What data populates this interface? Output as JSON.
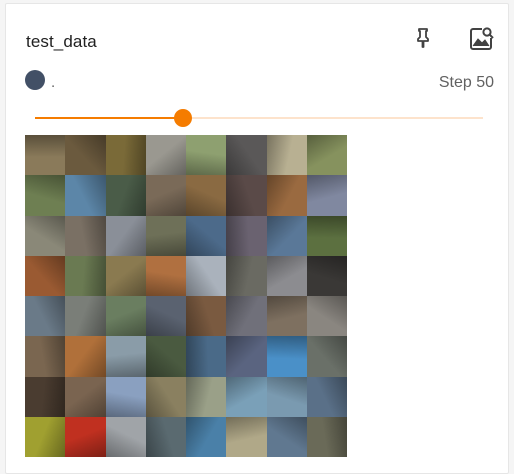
{
  "card": {
    "title": "test_data",
    "run_label": ".",
    "run_color": "#425066",
    "step_label": "Step 50"
  },
  "icons": {
    "pin": "pin-icon",
    "image_search": "image-search-icon"
  },
  "slider": {
    "value_fraction": 0.33,
    "accent": "#f57c00",
    "track_color": "#fde3cc"
  },
  "image_grid": {
    "rows": 8,
    "cols": 8,
    "tiles": [
      "#8a7a5a",
      "#6b5a3e",
      "#7a6a38",
      "#9a9890",
      "#8ea070",
      "#5a5858",
      "#b8b092",
      "#86925e",
      "#6e7f52",
      "#5c86a8",
      "#4a5c48",
      "#7a6a58",
      "#8a6a42",
      "#5a4a48",
      "#9a6a40",
      "#8088a0",
      "#8a8878",
      "#7a7064",
      "#8a8f98",
      "#6e7058",
      "#4c6a8a",
      "#6a6270",
      "#5a7898",
      "#5c7040",
      "#9a5a32",
      "#6a7a52",
      "#8a7a50",
      "#b07040",
      "#aab2bc",
      "#6a6a62",
      "#8c8c90",
      "#3a3836",
      "#6a7a88",
      "#7a7e78",
      "#6a7e60",
      "#5a6270",
      "#7a5a40",
      "#70707a",
      "#7e7060",
      "#8a8680",
      "#7a6650",
      "#b0703a",
      "#8a9ca8",
      "#4a5a40",
      "#4a6a88",
      "#5a6480",
      "#4a90c8",
      "#6a7068",
      "#4a3c30",
      "#7a6450",
      "#8aa0c0",
      "#8a8060",
      "#9aa088",
      "#7aa0b8",
      "#7a9ab0",
      "#5a7088",
      "#a0a030",
      "#c03020",
      "#a0a4a8",
      "#5a6a70",
      "#4a80a8",
      "#b0a888",
      "#607890",
      "#6a6a58"
    ]
  }
}
